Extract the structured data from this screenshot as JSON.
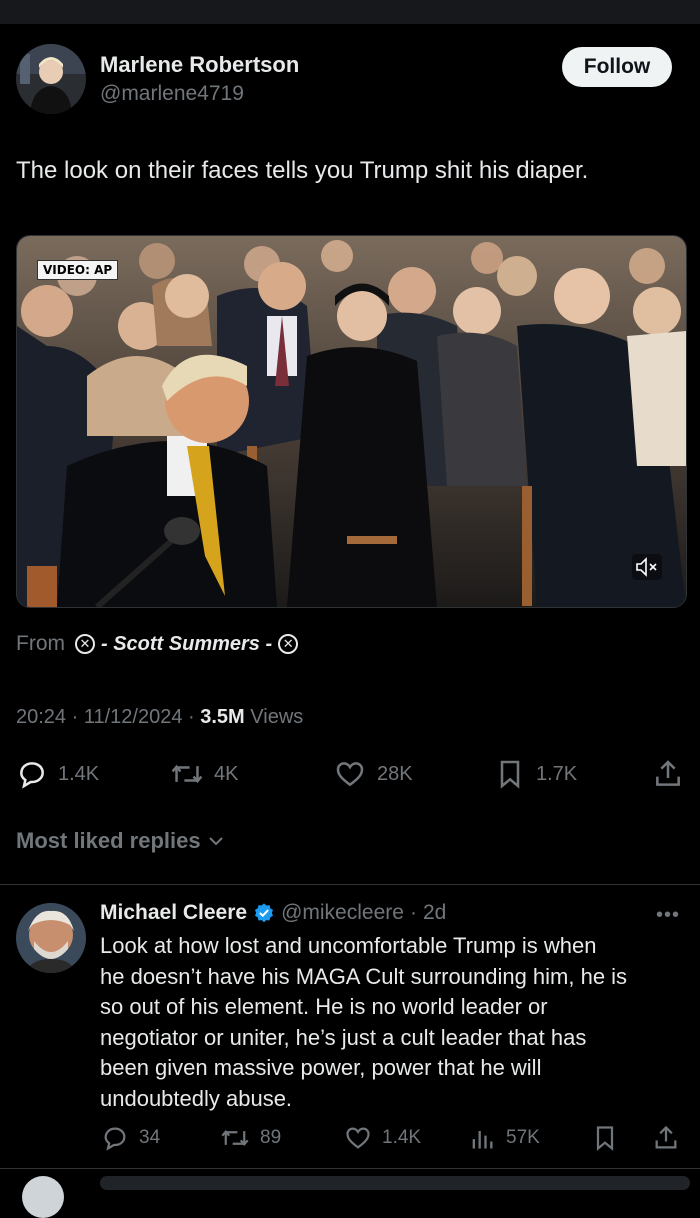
{
  "post": {
    "author_name": "Marlene Robertson",
    "author_handle": "@marlene4719",
    "follow_label": "Follow",
    "text": "The look on their faces tells you Trump shit his diaper.",
    "media_badge": "VIDEO: AP",
    "source_prefix": "From",
    "source_name": "- Scott Summers -",
    "source_icon": "x-circle-icon",
    "time": "20:24",
    "date": "11/12/2024",
    "views_count": "3.5M",
    "views_label": "Views",
    "stats": {
      "replies": "1.4K",
      "reposts": "4K",
      "likes": "28K",
      "bookmarks": "1.7K"
    }
  },
  "replies_header": "Most liked replies",
  "reply": {
    "name": "Michael Cleere",
    "handle": "@mikecleere",
    "age": "2d",
    "verified": true,
    "lines": [
      "Look at how lost and uncomfortable Trump is when",
      "he doesn’t have his MAGA Cult surrounding him, he is",
      "so out of his element. He is no world leader or",
      "negotiator or uniter, he’s just a cult leader that has",
      "been given massive power, power that he will",
      "undoubtedly abuse."
    ],
    "stats": {
      "replies": "34",
      "reposts": "89",
      "likes": "1.4K",
      "views": "57K"
    }
  },
  "colors": {
    "background": "#000000",
    "text_primary": "#e7e9ea",
    "text_secondary": "#71767b",
    "verified_blue": "#1d9bf0",
    "divider": "#2f3336"
  }
}
